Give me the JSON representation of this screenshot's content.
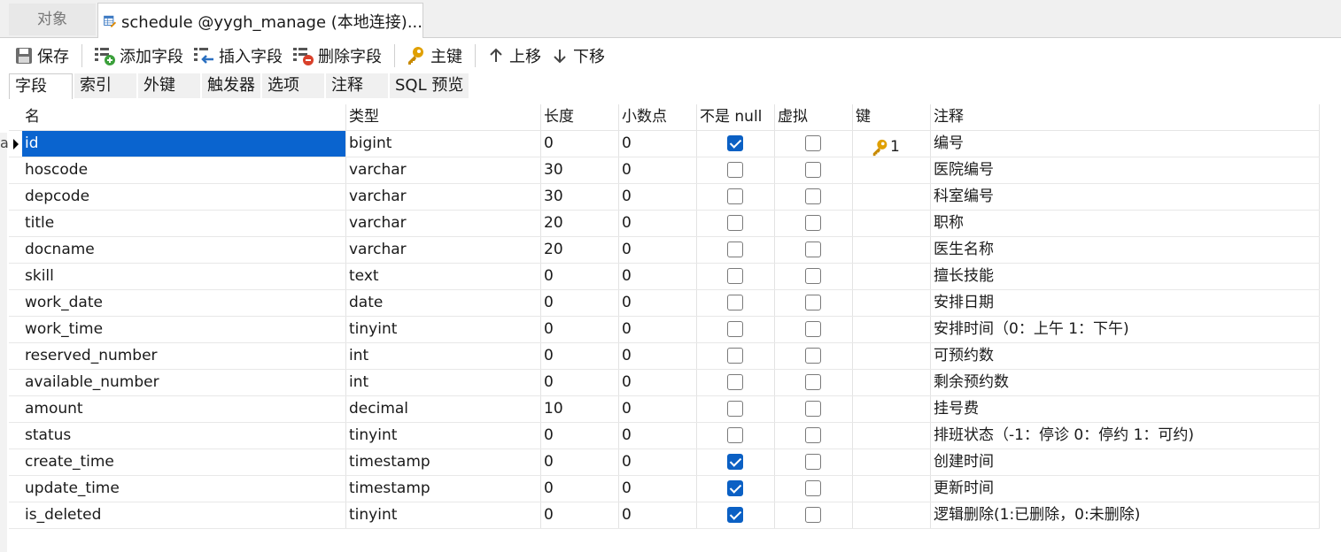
{
  "tabs": {
    "objects_label": "对象",
    "active_label": "schedule @yygh_manage (本地连接)..."
  },
  "toolbar": {
    "save": "保存",
    "add_field": "添加字段",
    "insert_field": "插入字段",
    "delete_field": "删除字段",
    "primary_key": "主键",
    "move_up": "上移",
    "move_down": "下移"
  },
  "subtabs": [
    "字段",
    "索引",
    "外键",
    "触发器",
    "选项",
    "注释",
    "SQL 预览"
  ],
  "columns": [
    "名",
    "类型",
    "长度",
    "小数点",
    "不是 null",
    "虚拟",
    "键",
    "注释"
  ],
  "rows": [
    {
      "name": "id",
      "type": "bigint",
      "length": "0",
      "decimals": "0",
      "not_null": true,
      "virtual": false,
      "key": "1",
      "comment": "编号"
    },
    {
      "name": "hoscode",
      "type": "varchar",
      "length": "30",
      "decimals": "0",
      "not_null": false,
      "virtual": false,
      "key": "",
      "comment": "医院编号"
    },
    {
      "name": "depcode",
      "type": "varchar",
      "length": "30",
      "decimals": "0",
      "not_null": false,
      "virtual": false,
      "key": "",
      "comment": "科室编号"
    },
    {
      "name": "title",
      "type": "varchar",
      "length": "20",
      "decimals": "0",
      "not_null": false,
      "virtual": false,
      "key": "",
      "comment": "职称"
    },
    {
      "name": "docname",
      "type": "varchar",
      "length": "20",
      "decimals": "0",
      "not_null": false,
      "virtual": false,
      "key": "",
      "comment": "医生名称"
    },
    {
      "name": "skill",
      "type": "text",
      "length": "0",
      "decimals": "0",
      "not_null": false,
      "virtual": false,
      "key": "",
      "comment": "擅长技能"
    },
    {
      "name": "work_date",
      "type": "date",
      "length": "0",
      "decimals": "0",
      "not_null": false,
      "virtual": false,
      "key": "",
      "comment": "安排日期"
    },
    {
      "name": "work_time",
      "type": "tinyint",
      "length": "0",
      "decimals": "0",
      "not_null": false,
      "virtual": false,
      "key": "",
      "comment": "安排时间（0：上午 1：下午)"
    },
    {
      "name": "reserved_number",
      "type": "int",
      "length": "0",
      "decimals": "0",
      "not_null": false,
      "virtual": false,
      "key": "",
      "comment": "可预约数"
    },
    {
      "name": "available_number",
      "type": "int",
      "length": "0",
      "decimals": "0",
      "not_null": false,
      "virtual": false,
      "key": "",
      "comment": "剩余预约数"
    },
    {
      "name": "amount",
      "type": "decimal",
      "length": "10",
      "decimals": "0",
      "not_null": false,
      "virtual": false,
      "key": "",
      "comment": "挂号费"
    },
    {
      "name": "status",
      "type": "tinyint",
      "length": "0",
      "decimals": "0",
      "not_null": false,
      "virtual": false,
      "key": "",
      "comment": "排班状态（-1：停诊 0：停约 1：可约)"
    },
    {
      "name": "create_time",
      "type": "timestamp",
      "length": "0",
      "decimals": "0",
      "not_null": true,
      "virtual": false,
      "key": "",
      "comment": "创建时间"
    },
    {
      "name": "update_time",
      "type": "timestamp",
      "length": "0",
      "decimals": "0",
      "not_null": true,
      "virtual": false,
      "key": "",
      "comment": "更新时间"
    },
    {
      "name": "is_deleted",
      "type": "tinyint",
      "length": "0",
      "decimals": "0",
      "not_null": true,
      "virtual": false,
      "key": "",
      "comment": "逻辑删除(1:已删除，0:未删除)"
    }
  ],
  "left_edge_char": "a",
  "colors": {
    "selection": "#0a64cf",
    "checkbox_on": "#0b60c4",
    "key_icon": "#e0a000"
  }
}
